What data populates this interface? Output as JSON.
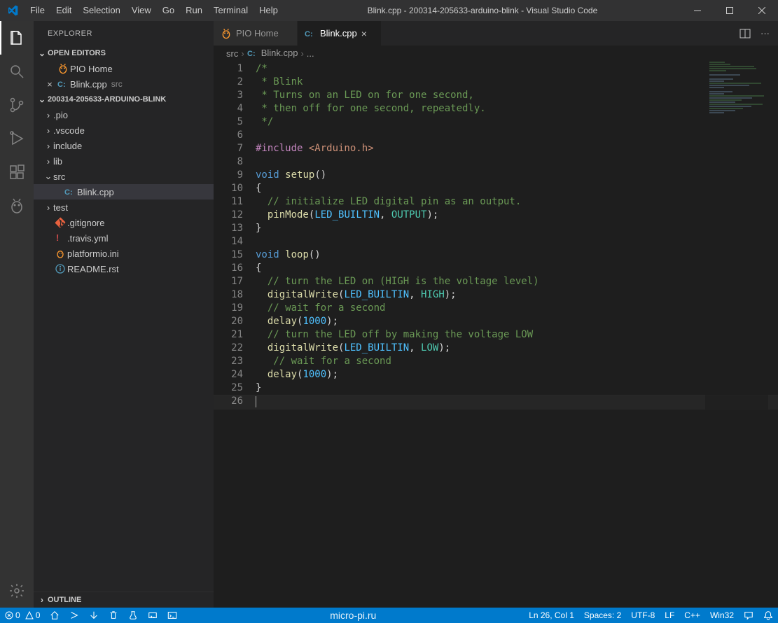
{
  "window": {
    "title": "Blink.cpp - 200314-205633-arduino-blink - Visual Studio Code"
  },
  "menu": [
    "File",
    "Edit",
    "Selection",
    "View",
    "Go",
    "Run",
    "Terminal",
    "Help"
  ],
  "explorer": {
    "title": "EXPLORER",
    "sections": {
      "open_editors": {
        "label": "OPEN EDITORS",
        "items": [
          {
            "label": "PIO Home",
            "icon": "pio"
          },
          {
            "label": "Blink.cpp",
            "suffix": "src",
            "icon": "cpp",
            "close": true
          }
        ]
      },
      "project": {
        "label": "200314-205633-ARDUINO-BLINK",
        "folders": [
          ".pio",
          ".vscode",
          "include",
          "lib"
        ],
        "src": {
          "label": "src",
          "children": [
            {
              "label": "Blink.cpp",
              "icon": "cpp",
              "active": true
            }
          ]
        },
        "folders2": [
          "test"
        ],
        "files": [
          {
            "label": ".gitignore",
            "icon": "git"
          },
          {
            "label": ".travis.yml",
            "icon": "yaml"
          },
          {
            "label": "platformio.ini",
            "icon": "ini"
          },
          {
            "label": "README.rst",
            "icon": "readme"
          }
        ]
      },
      "outline": {
        "label": "OUTLINE"
      }
    }
  },
  "tabs": [
    {
      "label": "PIO Home",
      "icon": "pio",
      "active": false
    },
    {
      "label": "Blink.cpp",
      "icon": "cpp",
      "active": true
    }
  ],
  "breadcrumb": [
    "src",
    "Blink.cpp",
    "..."
  ],
  "code": {
    "lines": [
      {
        "n": 1,
        "tokens": [
          {
            "t": "/*",
            "c": "comment"
          }
        ]
      },
      {
        "n": 2,
        "tokens": [
          {
            "t": " * Blink",
            "c": "comment"
          }
        ]
      },
      {
        "n": 3,
        "tokens": [
          {
            "t": " * Turns on an LED on for one second,",
            "c": "comment"
          }
        ]
      },
      {
        "n": 4,
        "tokens": [
          {
            "t": " * then off for one second, repeatedly.",
            "c": "comment"
          }
        ]
      },
      {
        "n": 5,
        "tokens": [
          {
            "t": " */",
            "c": "comment"
          }
        ]
      },
      {
        "n": 6,
        "tokens": []
      },
      {
        "n": 7,
        "tokens": [
          {
            "t": "#include ",
            "c": "preproc"
          },
          {
            "t": "<Arduino.h>",
            "c": "string"
          }
        ]
      },
      {
        "n": 8,
        "tokens": []
      },
      {
        "n": 9,
        "tokens": [
          {
            "t": "void",
            "c": "keyword"
          },
          {
            "t": " ",
            "c": "punct"
          },
          {
            "t": "setup",
            "c": "func"
          },
          {
            "t": "()",
            "c": "punct"
          }
        ]
      },
      {
        "n": 10,
        "tokens": [
          {
            "t": "{",
            "c": "punct"
          }
        ]
      },
      {
        "n": 11,
        "tokens": [
          {
            "t": "  ",
            "c": "punct"
          },
          {
            "t": "// initialize LED digital pin as an output.",
            "c": "comment"
          }
        ]
      },
      {
        "n": 12,
        "tokens": [
          {
            "t": "  ",
            "c": "punct"
          },
          {
            "t": "pinMode",
            "c": "func"
          },
          {
            "t": "(",
            "c": "punct"
          },
          {
            "t": "LED_BUILTIN",
            "c": "const"
          },
          {
            "t": ", ",
            "c": "punct"
          },
          {
            "t": "OUTPUT",
            "c": "builtin"
          },
          {
            "t": ");",
            "c": "punct"
          }
        ]
      },
      {
        "n": 13,
        "tokens": [
          {
            "t": "}",
            "c": "punct"
          }
        ]
      },
      {
        "n": 14,
        "tokens": []
      },
      {
        "n": 15,
        "tokens": [
          {
            "t": "void",
            "c": "keyword"
          },
          {
            "t": " ",
            "c": "punct"
          },
          {
            "t": "loop",
            "c": "func"
          },
          {
            "t": "()",
            "c": "punct"
          }
        ]
      },
      {
        "n": 16,
        "tokens": [
          {
            "t": "{",
            "c": "punct"
          }
        ]
      },
      {
        "n": 17,
        "tokens": [
          {
            "t": "  ",
            "c": "punct"
          },
          {
            "t": "// turn the LED on (HIGH is the voltage level)",
            "c": "comment"
          }
        ]
      },
      {
        "n": 18,
        "tokens": [
          {
            "t": "  ",
            "c": "punct"
          },
          {
            "t": "digitalWrite",
            "c": "func"
          },
          {
            "t": "(",
            "c": "punct"
          },
          {
            "t": "LED_BUILTIN",
            "c": "const"
          },
          {
            "t": ", ",
            "c": "punct"
          },
          {
            "t": "HIGH",
            "c": "builtin"
          },
          {
            "t": ");",
            "c": "punct"
          }
        ]
      },
      {
        "n": 19,
        "tokens": [
          {
            "t": "  ",
            "c": "punct"
          },
          {
            "t": "// wait for a second",
            "c": "comment"
          }
        ]
      },
      {
        "n": 20,
        "tokens": [
          {
            "t": "  ",
            "c": "punct"
          },
          {
            "t": "delay",
            "c": "func"
          },
          {
            "t": "(",
            "c": "punct"
          },
          {
            "t": "1000",
            "c": "const"
          },
          {
            "t": ");",
            "c": "punct"
          }
        ]
      },
      {
        "n": 21,
        "tokens": [
          {
            "t": "  ",
            "c": "punct"
          },
          {
            "t": "// turn the LED off by making the voltage LOW",
            "c": "comment"
          }
        ]
      },
      {
        "n": 22,
        "tokens": [
          {
            "t": "  ",
            "c": "punct"
          },
          {
            "t": "digitalWrite",
            "c": "func"
          },
          {
            "t": "(",
            "c": "punct"
          },
          {
            "t": "LED_BUILTIN",
            "c": "const"
          },
          {
            "t": ", ",
            "c": "punct"
          },
          {
            "t": "LOW",
            "c": "builtin"
          },
          {
            "t": ");",
            "c": "punct"
          }
        ]
      },
      {
        "n": 23,
        "tokens": [
          {
            "t": "   ",
            "c": "punct"
          },
          {
            "t": "// wait for a second",
            "c": "comment"
          }
        ]
      },
      {
        "n": 24,
        "tokens": [
          {
            "t": "  ",
            "c": "punct"
          },
          {
            "t": "delay",
            "c": "func"
          },
          {
            "t": "(",
            "c": "punct"
          },
          {
            "t": "1000",
            "c": "const"
          },
          {
            "t": ");",
            "c": "punct"
          }
        ]
      },
      {
        "n": 25,
        "tokens": [
          {
            "t": "}",
            "c": "punct"
          }
        ]
      },
      {
        "n": 26,
        "tokens": [],
        "current": true
      }
    ]
  },
  "statusbar": {
    "left": {
      "errors": "0",
      "warnings": "0"
    },
    "watermark": "micro-pi.ru",
    "right": {
      "cursor": "Ln 26, Col 1",
      "spaces": "Spaces: 2",
      "encoding": "UTF-8",
      "eol": "LF",
      "lang": "C++",
      "platform": "Win32"
    }
  }
}
